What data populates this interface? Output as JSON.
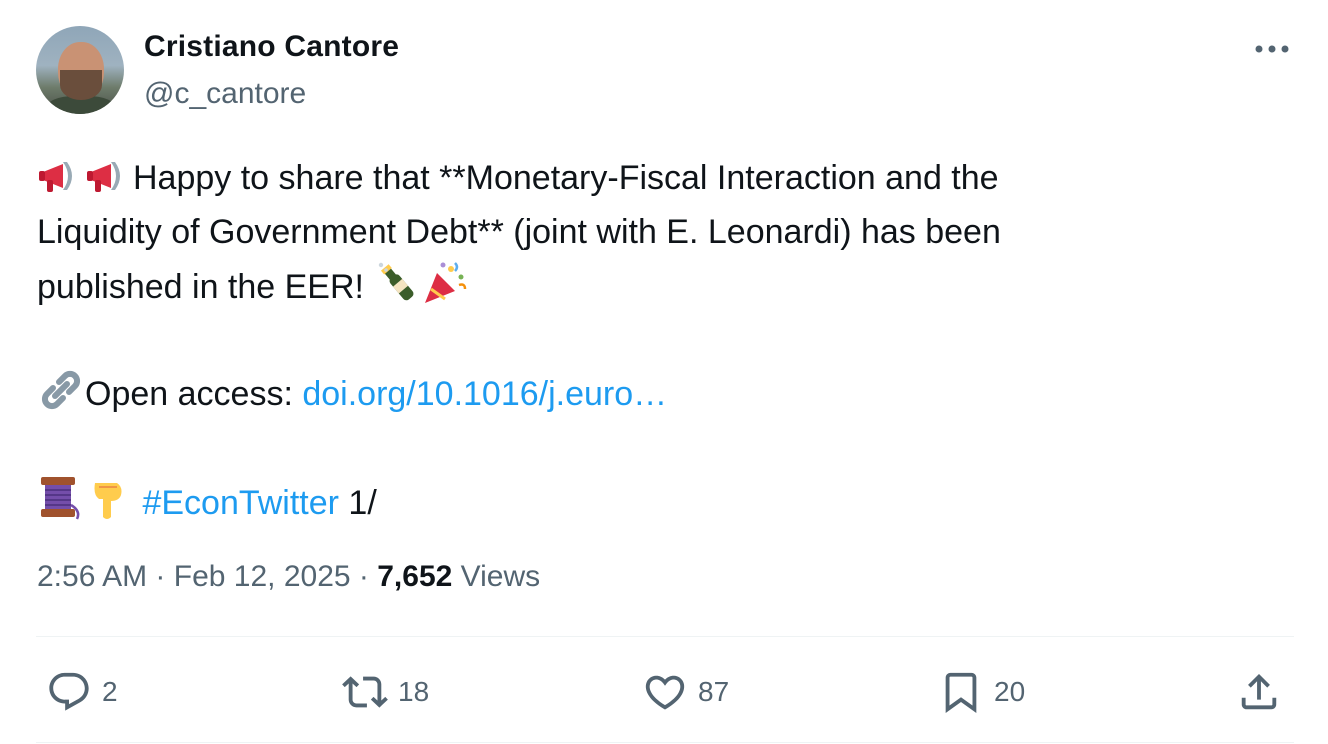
{
  "author": {
    "display_name": "Cristiano Cantore",
    "handle": "@c_cantore"
  },
  "tweet": {
    "line1_text": "Happy to share that **Monetary-Fiscal Interaction and the",
    "line2_text": "Liquidity of Government Debt** (joint with E. Leonardi)  has been",
    "line3_text": "published in the EER! ",
    "open_access_label": "Open access: ",
    "link_text": "doi.org/10.1016/j.euro…",
    "hashtag": "#EconTwitter",
    "thread_marker": " 1/",
    "emojis": [
      "megaphone-icon",
      "megaphone-icon",
      "champagne-icon",
      "party-popper-icon",
      "link-icon",
      "thread-spool-icon",
      "pointing-down-icon"
    ]
  },
  "meta": {
    "time": "2:56 AM",
    "separator": " · ",
    "date": "Feb 12, 2025",
    "views_count": "7,652",
    "views_label": " Views"
  },
  "actions": {
    "replies": "2",
    "reposts": "18",
    "likes": "87",
    "bookmarks": "20"
  },
  "colors": {
    "link": "#1d9bf0",
    "secondary_text": "#536471",
    "primary_text": "#0f1419"
  }
}
